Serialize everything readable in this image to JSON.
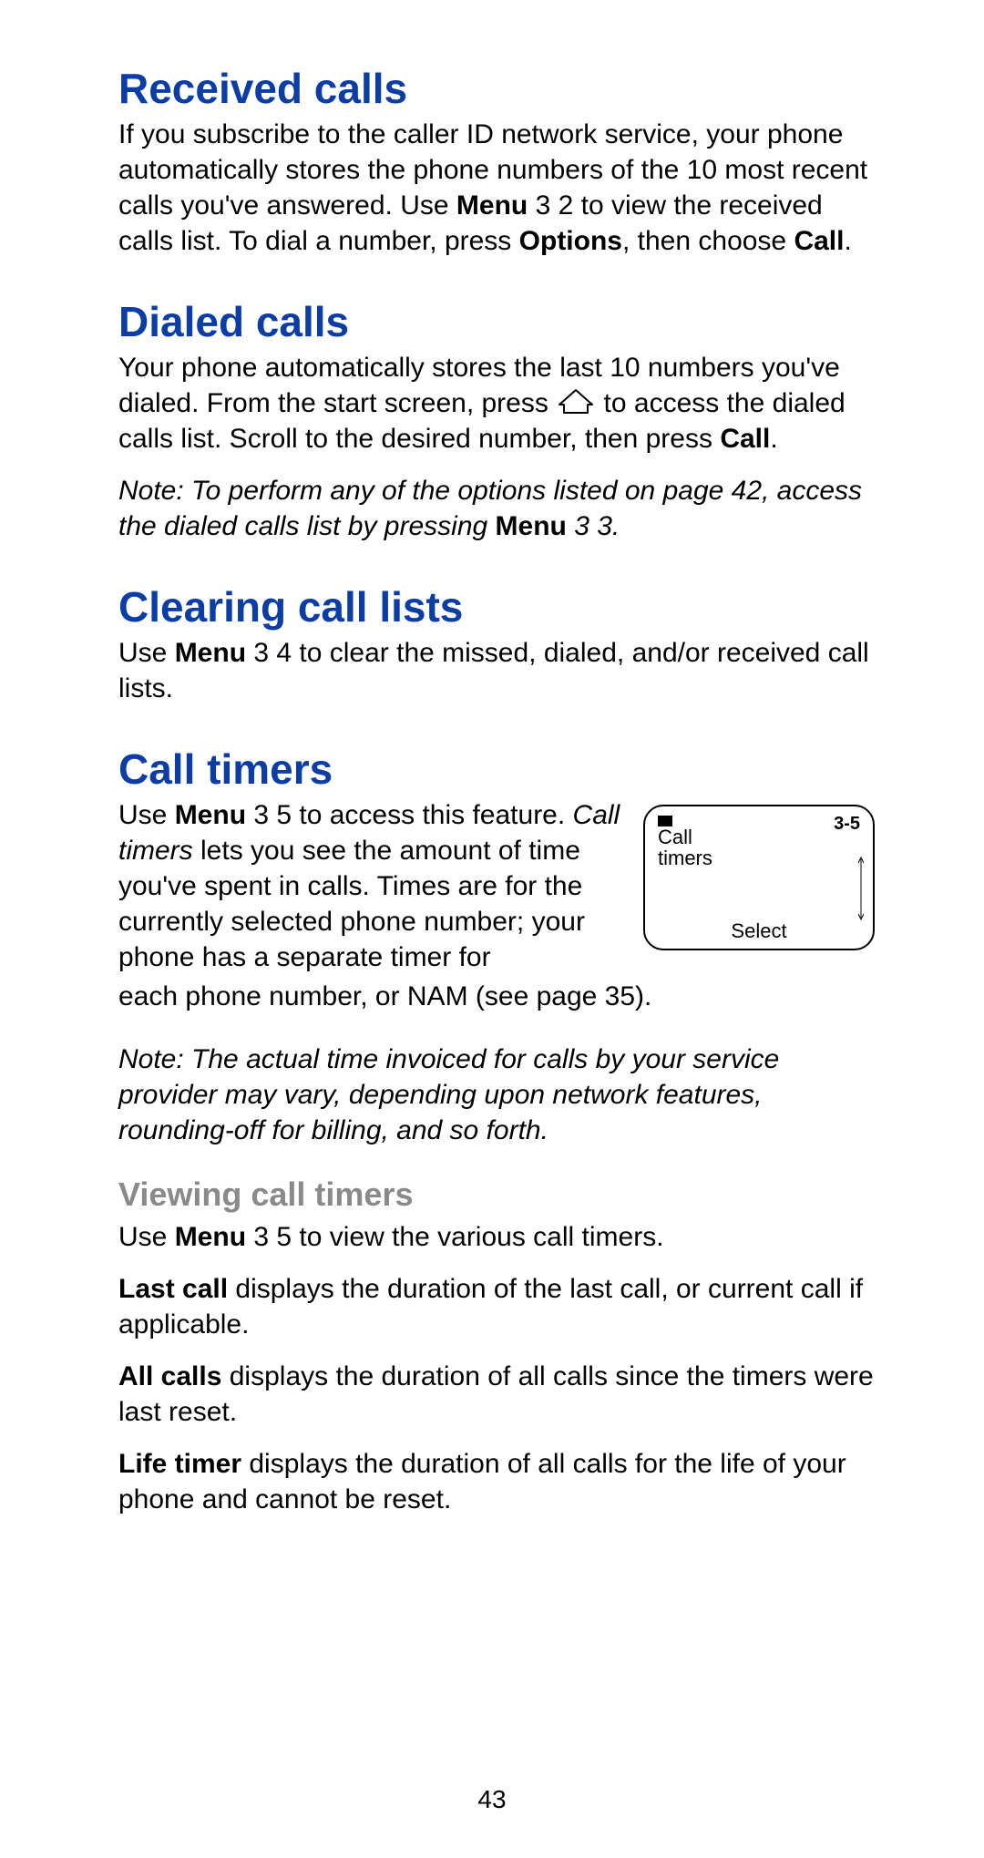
{
  "pageNumber": "43",
  "sections": {
    "received": {
      "heading": "Received calls",
      "body_parts": [
        "If you subscribe to the caller ID network service, your phone automatically stores the phone numbers of the 10 most recent calls you've answered. Use ",
        "Menu",
        " 3 2 to view the received calls list. To dial a number, press ",
        "Options",
        ", then choose ",
        "Call",
        "."
      ]
    },
    "dialed": {
      "heading": "Dialed calls",
      "body_parts_1": [
        "Your phone automatically stores the last 10 numbers you've dialed. From the start screen, press "
      ],
      "body_parts_2": [
        " to access the dialed calls list. Scroll to the desired number, then press ",
        "Call",
        "."
      ],
      "note_parts": [
        "Note:  To perform any of the options listed on page 42, access the dialed calls list by pressing ",
        "Menu",
        " 3 3."
      ]
    },
    "clearing": {
      "heading": "Clearing call lists",
      "body_parts": [
        "Use ",
        "Menu",
        " 3 4 to clear the missed, dialed, and/or received call lists."
      ]
    },
    "timers": {
      "heading": "Call timers",
      "intro_parts": [
        "Use ",
        "Menu",
        " 3 5 to access this feature. ",
        "Call timers",
        " lets you see the amount of time you've spent in calls. Times are for the currently selected phone number; your phone has a separate timer for "
      ],
      "intro_after": "each phone number, or NAM (see page 35).",
      "note": "Note:  The actual time invoiced for calls by your service provider may vary, depending upon network features, rounding-off for billing, and so forth.",
      "screen": {
        "menuNum": "3-5",
        "line1": "Call",
        "line2": "timers",
        "softkey": "Select"
      },
      "viewing": {
        "heading": "Viewing call timers",
        "intro_parts": [
          "Use ",
          "Menu",
          " 3 5 to view the various call timers."
        ],
        "last_parts": [
          "Last call",
          " displays the duration of the last call, or current call if applicable."
        ],
        "all_parts": [
          "All calls",
          " displays the duration of all calls since the timers were last reset."
        ],
        "life_parts": [
          "Life timer",
          " displays the duration of all calls for the life of your phone and cannot be reset."
        ]
      }
    }
  }
}
